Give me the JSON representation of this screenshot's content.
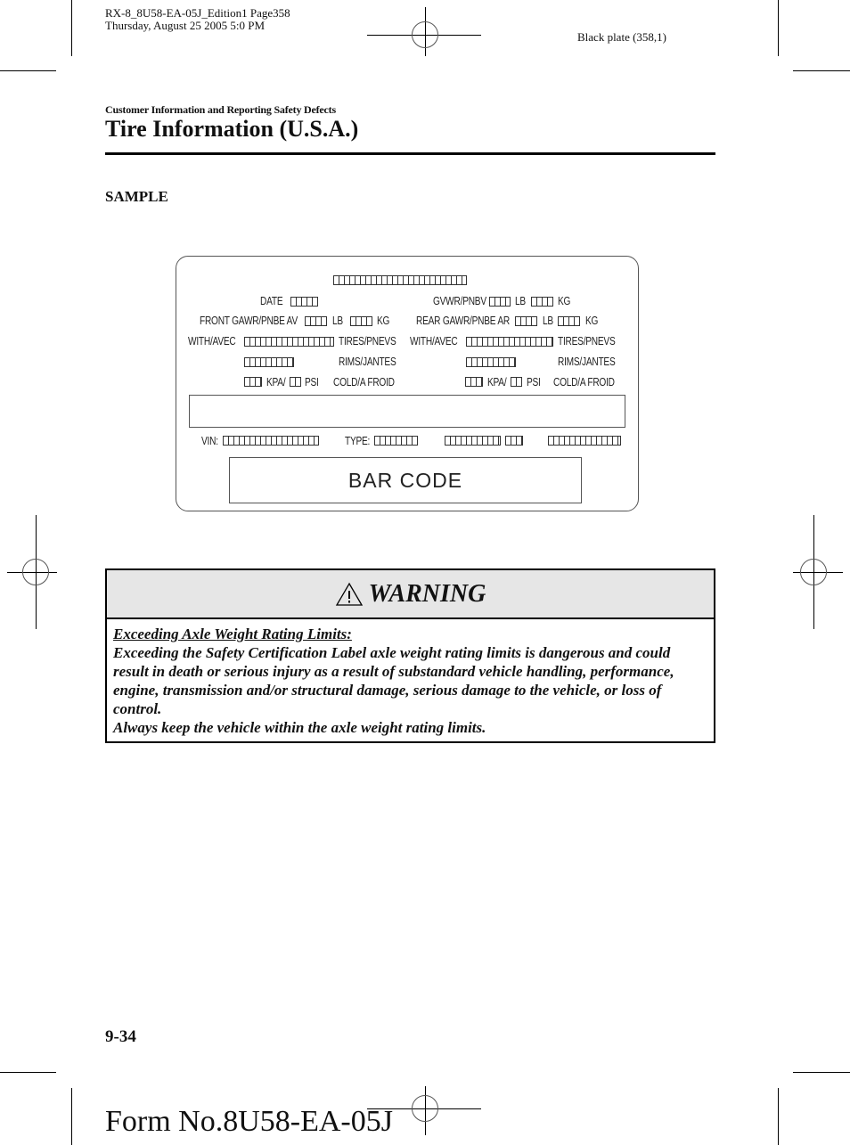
{
  "print_header": {
    "line1": "RX-8_8U58-EA-05J_Edition1 Page358",
    "line2": "Thursday, August 25 2005 5:0 PM",
    "plate": "Black plate (358,1)"
  },
  "section": {
    "label": "Customer Information and Reporting Safety Defects",
    "title": "Tire Information (U.S.A.)"
  },
  "sample_heading": "SAMPLE",
  "tire_label": {
    "date": "DATE",
    "gvwr": "GVWR/PNBV",
    "front_gawr": "FRONT GAWR/PNBE AV",
    "rear_gawr": "REAR GAWR/PNBE AR",
    "lb": "LB",
    "kg": "KG",
    "with_avec": "WITH/AVEC",
    "tires": "TIRES/PNEVS",
    "rims": "RIMS/JANTES",
    "kpa": "KPA/",
    "psi": "PSI",
    "cold": "COLD/A FROID",
    "vin": "VIN:",
    "type": "TYPE:",
    "barcode": "BAR CODE"
  },
  "warning": {
    "title": "WARNING",
    "icon": "warning-triangle-icon",
    "subtitle": "Exceeding Axle Weight Rating Limits:",
    "body": "Exceeding the Safety Certification Label axle weight rating limits is dangerous and could result in death or serious injury as a result of substandard vehicle handling, performance, engine, transmission and/or structural damage, serious damage to the vehicle, or loss of control.",
    "advice": "Always keep the vehicle within the axle weight rating limits."
  },
  "footer": {
    "page_number": "9-34",
    "form_number": "Form No.8U58-EA-05J"
  }
}
